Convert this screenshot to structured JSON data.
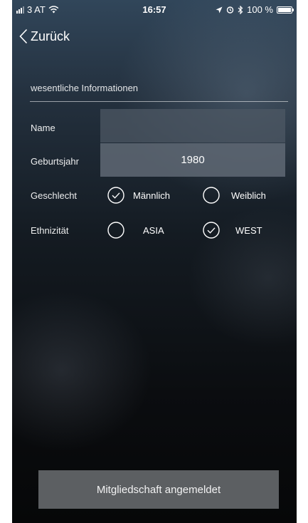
{
  "status_bar": {
    "carrier": "3 AT",
    "time": "16:57",
    "battery": "100 %",
    "battery_level": 1.0,
    "icons": [
      "signal-icon",
      "wifi-icon",
      "location-arrow-icon",
      "alarm-icon",
      "bluetooth-icon",
      "battery-icon"
    ]
  },
  "nav": {
    "back_label": "Zurück"
  },
  "form": {
    "section_title": "wesentliche Informationen",
    "name_label": "Name",
    "name_value": "",
    "birth_year_label": "Geburtsjahr",
    "birth_year_value": "1980",
    "gender_label": "Geschlecht",
    "gender_options": [
      {
        "label": "Männlich",
        "selected": true
      },
      {
        "label": "Weiblich",
        "selected": false
      }
    ],
    "ethnicity_label": "Ethnizität",
    "ethnicity_options": [
      {
        "label": "ASIA",
        "selected": false
      },
      {
        "label": "WEST",
        "selected": true
      }
    ]
  },
  "footer": {
    "button_label": "Mitgliedschaft angemeldet"
  },
  "colors": {
    "background_top": "#31465a",
    "background_bottom": "#060708",
    "field_name": "#4e5864",
    "field_year": "#5f6974",
    "button": "#5c5f62"
  }
}
